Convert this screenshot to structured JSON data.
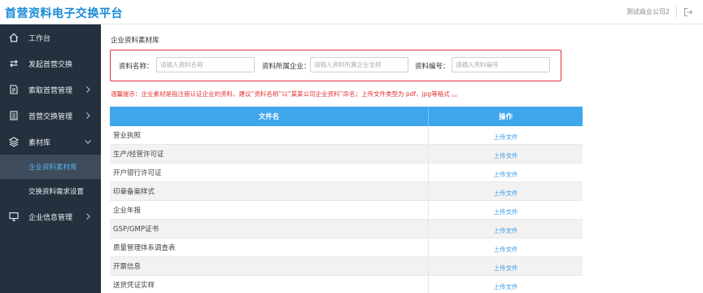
{
  "header": {
    "title": "首营资料电子交换平台",
    "user": "测试商业公司2"
  },
  "sidebar": {
    "items": [
      {
        "label": "工作台",
        "icon": "home-icon",
        "name": "workbench"
      },
      {
        "label": "发起首营交换",
        "icon": "exchange-icon",
        "name": "start-exchange"
      },
      {
        "label": "索取首营管理",
        "icon": "request-icon",
        "name": "request-management",
        "caret": "right"
      },
      {
        "label": "首营交换管理",
        "icon": "document-icon",
        "name": "exchange-management",
        "caret": "right"
      },
      {
        "label": "素材库",
        "icon": "layers-icon",
        "name": "material-library",
        "caret": "down"
      },
      {
        "label": "企业信息管理",
        "icon": "monitor-icon",
        "name": "company-info",
        "caret": "right"
      }
    ],
    "sub_items": [
      {
        "label": "企业资料素材库",
        "active": true
      },
      {
        "label": "交换资料需求设置",
        "active": false
      }
    ]
  },
  "main": {
    "section_title": "企业资料素材库",
    "search": {
      "name_label": "资料名称：",
      "name_placeholder": "请输入资料名称",
      "company_label": "资料所属企业：",
      "company_placeholder": "请输入资料所属企业全称",
      "code_label": "资料编号：",
      "code_placeholder": "请输入资料编号"
    },
    "hint": "温馨提示：企业素材是指注册认证企业的资料，建议“资料名称”以“某某公司企业资料”命名；上传文件类型为 pdf、jpg等格式 。。",
    "table": {
      "col_name": "文件名",
      "col_op": "操作",
      "action_label": "上传文件",
      "rows": [
        "营业执照",
        "生产/经营许可证",
        "开户银行许可证",
        "印章备案样式",
        "企业年报",
        "GSP/GMP证书",
        "质量管理体系调查表",
        "开票信息",
        "送货凭证实样"
      ]
    }
  },
  "colors": {
    "brand": "#1a8bd8",
    "sidebar_bg": "#24303d",
    "table_header": "#3fa6ec",
    "hint": "#e62e2e",
    "link": "#3a9ae8"
  }
}
